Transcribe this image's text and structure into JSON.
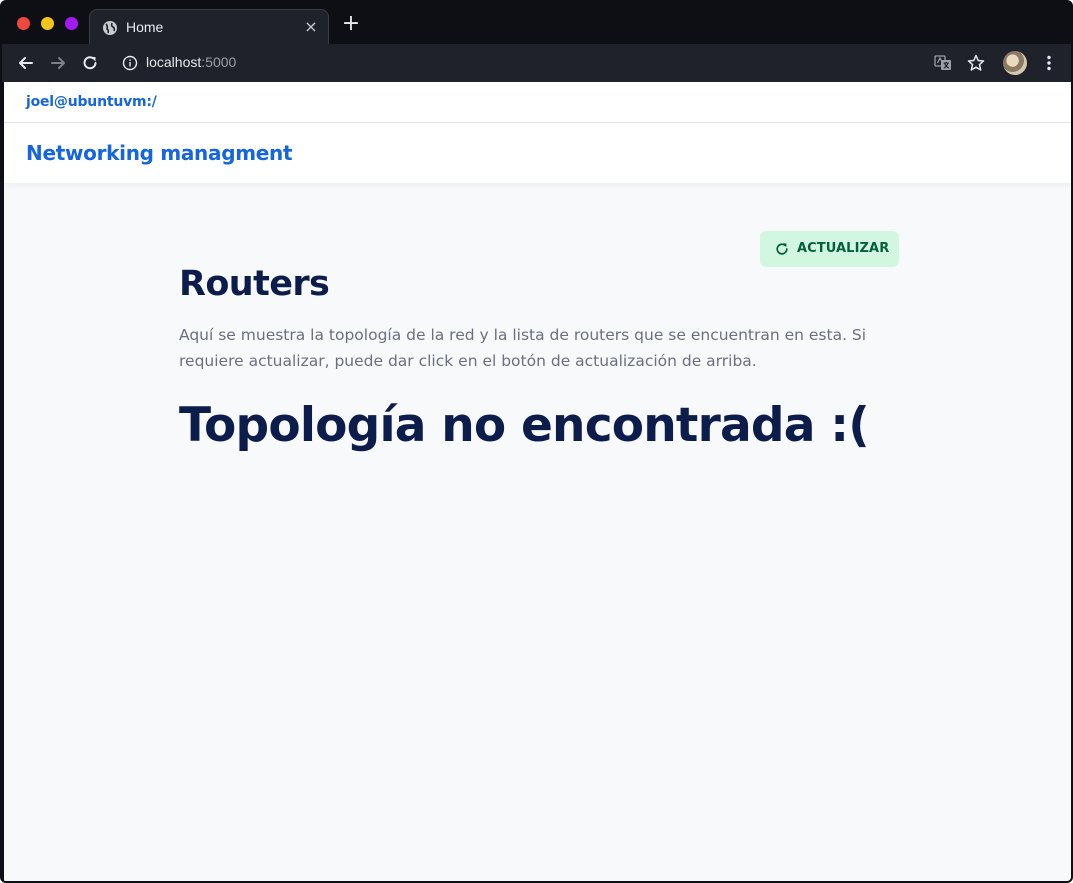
{
  "browser": {
    "tab_title": "Home",
    "tab_close_glyph": "×",
    "new_tab_glyph": "+",
    "address_host": "localhost",
    "address_port": ":5000",
    "icons": [
      "globe-icon",
      "back-icon",
      "forward-icon",
      "reload-icon",
      "info-icon",
      "translate-icon",
      "star-icon",
      "avatar",
      "menu-icon"
    ]
  },
  "header": {
    "user_path": "joel@ubuntuvm:/",
    "brand": "Networking managment"
  },
  "main": {
    "refresh_label": "ACTUALIZAR",
    "title": "Routers",
    "description": "Aquí se muestra la topología de la red y la lista de routers que se encuentran en esta. Si requiere actualizar, puede dar click en el botón de actualización de arriba.",
    "not_found": "Topología no encontrada :("
  },
  "colors": {
    "brand": "#1565e0",
    "heading": "#0c1c4b",
    "refresh_bg": "#d2f7e1",
    "refresh_text": "#05603a",
    "page_bg": "#f8f9fb"
  }
}
